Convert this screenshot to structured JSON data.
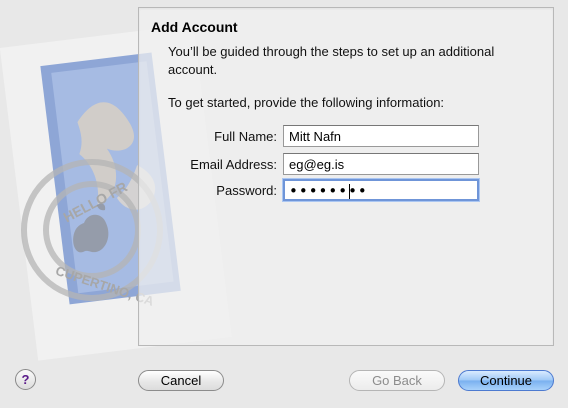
{
  "dialog": {
    "title": "Add Account",
    "intro": "You’ll be guided through the steps to set up an additional account.",
    "prompt": "To get started, provide the following information:"
  },
  "form": {
    "full_name_label": "Full Name:",
    "full_name_value": "Mitt Nafn",
    "email_label": "Email Address:",
    "email_value": "eg@eg.is",
    "password_label": "Password:",
    "password_value": "••••••••"
  },
  "buttons": {
    "help": "?",
    "cancel": "Cancel",
    "go_back": "Go Back",
    "continue": "Continue"
  },
  "stamp": {
    "postmark_text_top": "HELLO FR",
    "postmark_text_bottom": "CUPERTINO, CA"
  },
  "colors": {
    "accent": "#6f95d8",
    "default_button": "#79b0ef",
    "help_glyph": "#5a1a8a"
  },
  "icons": {
    "app_icon": "mail-stamp-icon",
    "help": "help-icon"
  }
}
